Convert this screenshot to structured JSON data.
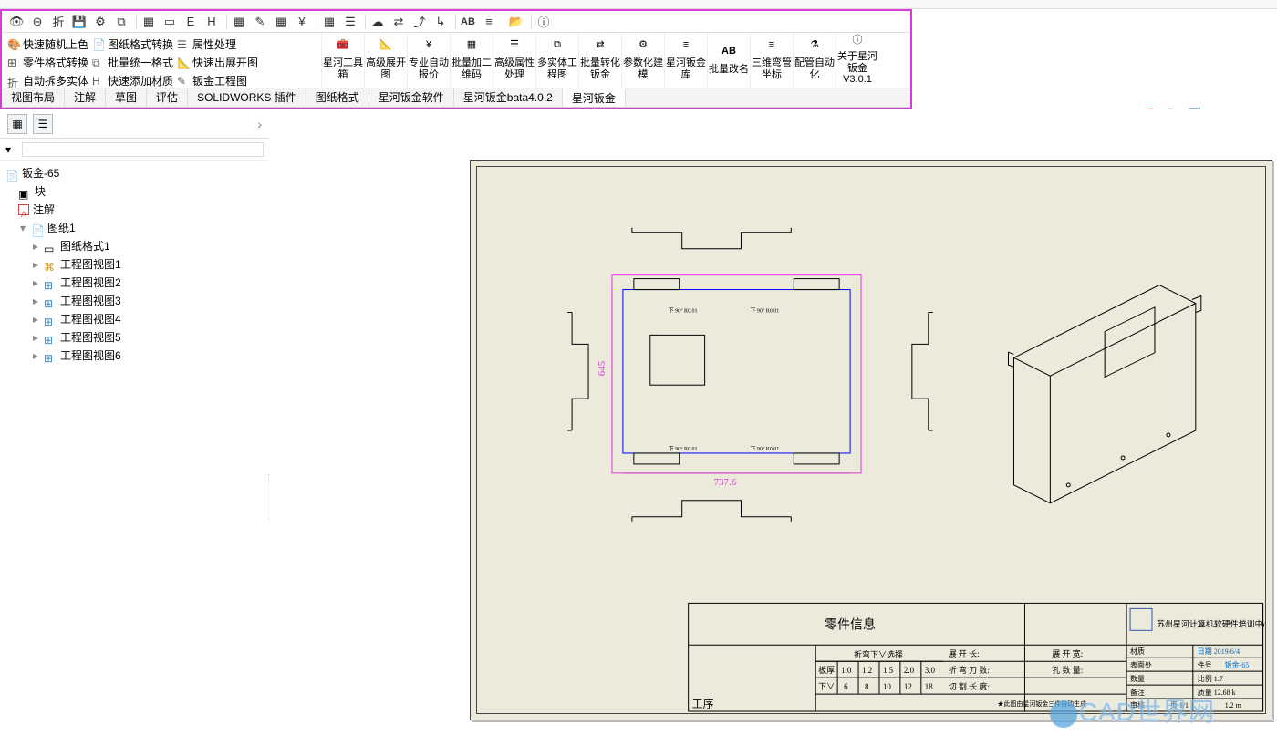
{
  "mini_toolbar": [
    "eye",
    "circle",
    "fold",
    "save",
    "gear",
    "star",
    "calc",
    "box",
    "E",
    "H",
    "grid1",
    "pencil",
    "grid2",
    "curr",
    "grid3",
    "list",
    "cloud",
    "swap",
    "sock",
    "angle",
    "AB",
    "sliders",
    "open",
    "info"
  ],
  "ribbon_left": {
    "r1": [
      {
        "label": "快速随机上色"
      },
      {
        "label": "图纸格式转换"
      },
      {
        "label": "属性处理"
      }
    ],
    "r2": [
      {
        "label": "零件格式转换"
      },
      {
        "label": "批量统一格式"
      },
      {
        "label": "快速出展开图"
      }
    ],
    "r3": [
      {
        "label": "自动拆多实体"
      },
      {
        "label": "快速添加材质"
      },
      {
        "label": "钣金工程图"
      }
    ]
  },
  "ribbon_right": [
    "星河工具箱",
    "高级展开图",
    "专业自动报价",
    "批量加二维码",
    "高级属性处理",
    "多实体工程图",
    "批量转化钣金",
    "参数化建模",
    "星河钣金库",
    "批量改名",
    "三维弯管坐标",
    "配管自动化",
    "关于星河钣金V3.0.1"
  ],
  "tabs": [
    "视图布局",
    "注解",
    "草图",
    "评估",
    "SOLIDWORKS 插件",
    "图纸格式",
    "星河钣金软件",
    "星河钣金bata4.0.2",
    "星河钣金"
  ],
  "active_tab": 8,
  "tree": {
    "root": "钣金-65",
    "items": [
      {
        "label": "块",
        "ico": "block"
      },
      {
        "label": "注解",
        "ico": "A"
      },
      {
        "label": "图纸1",
        "ico": "sheet",
        "expanded": true,
        "children": [
          {
            "label": "图纸格式1"
          },
          {
            "label": "工程图视图1"
          },
          {
            "label": "工程图视图2"
          },
          {
            "label": "工程图视图3"
          },
          {
            "label": "工程图视图4"
          },
          {
            "label": "工程图视图5"
          },
          {
            "label": "工程图视图6"
          }
        ]
      }
    ]
  },
  "drawing": {
    "dim_v": "645",
    "dim_h": "737.6",
    "title_block": {
      "part_info_label": "零件信息",
      "company": "苏州星河计算机软硬件培训中心",
      "process_label": "工序",
      "bend_sel": "折弯下∨选择",
      "row1_label": "板厚",
      "row1_vals": [
        "1.0",
        "1.2",
        "1.5",
        "2.0",
        "3.0"
      ],
      "row2_label": "下∨",
      "row2_vals": [
        "6",
        "8",
        "10",
        "12",
        "18"
      ],
      "unfold_len": "展 开 长:",
      "unfold_wid": "展 开 宽:",
      "bend_knife": "折 弯 刀 数:",
      "hole_count": "孔  数  量:",
      "cut_len": "切 割 长 度:",
      "date": "2019/6/4",
      "partnum": "钣金-65",
      "scale": "1:7",
      "sheet": "1/1",
      "wt": "12.68 k",
      "rev": "1.2 m"
    }
  },
  "watermark": "CAD世界网"
}
